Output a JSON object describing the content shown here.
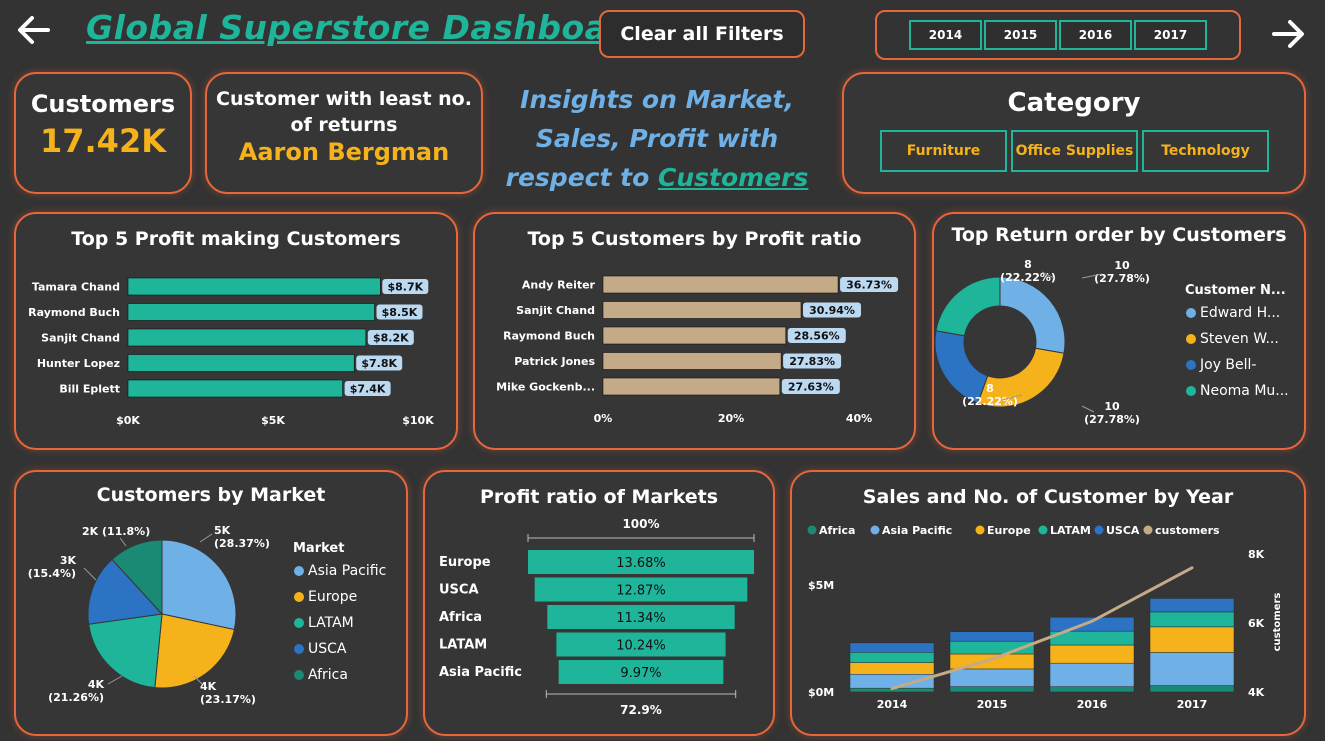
{
  "header": {
    "title": "Global Superstore Dashboard",
    "clear_label": "Clear all Filters",
    "years": [
      "2014",
      "2015",
      "2016",
      "2017"
    ]
  },
  "kpi_customers": {
    "label": "Customers",
    "value": "17.42K"
  },
  "kpi_least_returns": {
    "line1": "Customer with least no.",
    "line2": "of returns",
    "value": "Aaron Bergman"
  },
  "insight": {
    "line1": "Insights on Market,",
    "line2": "Sales, Profit with",
    "line3a": "respect to ",
    "line3b": "Customers"
  },
  "category": {
    "title": "Category",
    "items": [
      "Furniture",
      "Office Supplies",
      "Technology"
    ]
  },
  "colors": {
    "accent": "#e8663b",
    "teal": "#1fb59a",
    "gold": "#f5b21a",
    "blue": "#6fb0e6",
    "darkblue": "#2c73c4",
    "tan": "#c5aa88",
    "darkteal": "#1a8a74"
  },
  "chart_data": [
    {
      "id": "profit_customers",
      "type": "bar",
      "title": "Top 5 Profit making Customers",
      "categories": [
        "Tamara Chand",
        "Raymond Buch",
        "Sanjit Chand",
        "Hunter Lopez",
        "Bill Eplett"
      ],
      "values": [
        8.7,
        8.5,
        8.2,
        7.8,
        7.4
      ],
      "labels": [
        "$8.7K",
        "$8.5K",
        "$8.2K",
        "$7.8K",
        "$7.4K"
      ],
      "ticks": [
        "$0K",
        "$5K",
        "$10K"
      ],
      "xlim": [
        0,
        10
      ]
    },
    {
      "id": "profit_ratio_customers",
      "type": "bar",
      "title": "Top 5 Customers by Profit ratio",
      "categories": [
        "Andy Reiter",
        "Sanjit Chand",
        "Raymond Buch",
        "Patrick Jones",
        "Mike Gockenb..."
      ],
      "values": [
        36.73,
        30.94,
        28.56,
        27.83,
        27.63
      ],
      "labels": [
        "36.73%",
        "30.94%",
        "28.56%",
        "27.83%",
        "27.63%"
      ],
      "ticks": [
        "0%",
        "20%",
        "40%"
      ],
      "xlim": [
        0,
        40
      ]
    },
    {
      "id": "return_orders",
      "type": "pie",
      "title": "Top Return order by Customers",
      "legend_title": "Customer N...",
      "categories": [
        "Edward H...",
        "Steven W...",
        "Joy Bell-",
        "Neoma Mu..."
      ],
      "values": [
        10,
        10,
        8,
        8
      ],
      "labels": [
        "10",
        "10",
        "8",
        "8"
      ],
      "pct": [
        "(27.78%)",
        "(27.78%)",
        "(22.22%)",
        "(22.22%)"
      ]
    },
    {
      "id": "market_customers",
      "type": "pie",
      "title": "Customers by Market",
      "legend_title": "Market",
      "categories": [
        "Asia Pacific",
        "Europe",
        "LATAM",
        "USCA",
        "Africa"
      ],
      "values": [
        28.37,
        23.17,
        21.26,
        15.4,
        11.8
      ],
      "labels": [
        "5K",
        "4K",
        "4K",
        "3K",
        "2K (11.8%)"
      ],
      "pct": [
        "(28.37%)",
        "(23.17%)",
        "(21.26%)",
        "(15.4%)",
        ""
      ]
    },
    {
      "id": "market_profit_ratio",
      "type": "bar",
      "title": "Profit ratio of Markets",
      "top_label": "100%",
      "bottom_label": "72.9%",
      "categories": [
        "Europe",
        "USCA",
        "Africa",
        "LATAM",
        "Asia Pacific"
      ],
      "values": [
        13.68,
        12.87,
        11.34,
        10.24,
        9.97
      ],
      "labels": [
        "13.68%",
        "12.87%",
        "11.34%",
        "10.24%",
        "9.97%"
      ]
    },
    {
      "id": "sales_year",
      "type": "bar",
      "title": "Sales and No. of Customer by Year",
      "legend": [
        "Africa",
        "Asia Pacific",
        "Europe",
        "LATAM",
        "USCA",
        "customers"
      ],
      "categories": [
        "2014",
        "2015",
        "2016",
        "2017"
      ],
      "series": [
        {
          "name": "Africa",
          "values": [
            0.18,
            0.25,
            0.25,
            0.3
          ]
        },
        {
          "name": "Asia Pacific",
          "values": [
            0.65,
            0.83,
            1.1,
            1.55
          ]
        },
        {
          "name": "Europe",
          "values": [
            0.55,
            0.7,
            0.85,
            1.2
          ]
        },
        {
          "name": "LATAM",
          "values": [
            0.48,
            0.6,
            0.65,
            0.7
          ]
        },
        {
          "name": "USCA",
          "values": [
            0.44,
            0.44,
            0.65,
            0.63
          ]
        }
      ],
      "customers": [
        4.1,
        4.95,
        6.05,
        7.6
      ],
      "y_ticks": [
        "$0M",
        "$5M"
      ],
      "y2_ticks": [
        "4K",
        "6K",
        "8K"
      ],
      "y2_label": "customers",
      "ylim": [
        0,
        5.9
      ],
      "y2lim": [
        4,
        8
      ]
    }
  ]
}
